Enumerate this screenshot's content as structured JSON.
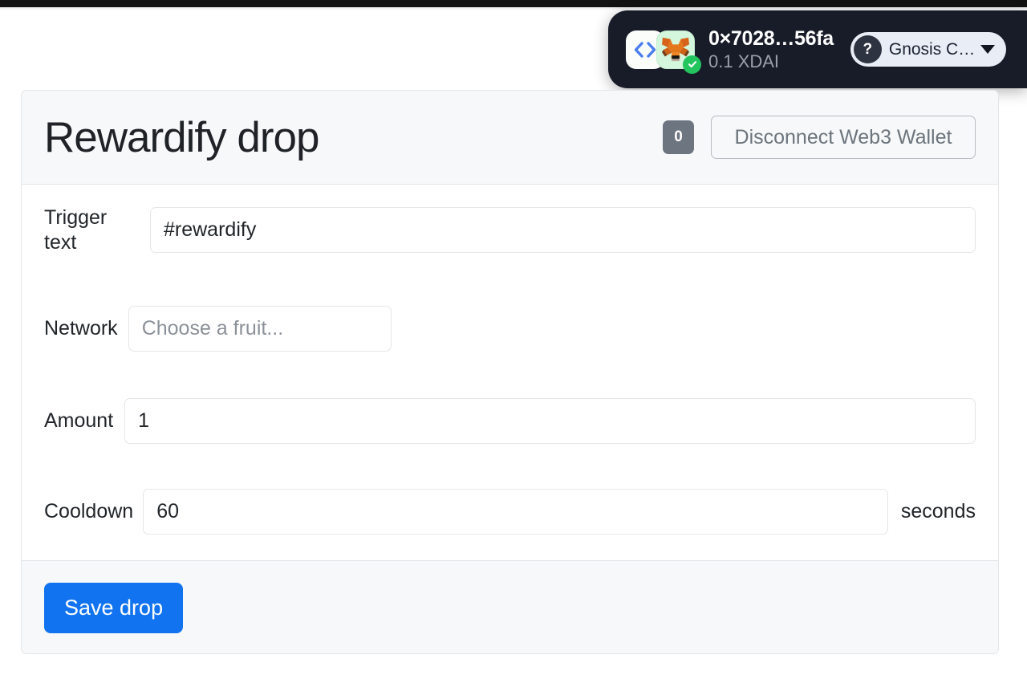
{
  "wallet": {
    "code_icon": "code-brackets-icon",
    "wallet_icon": "metamask-fox-icon",
    "status_icon": "connected-check-icon",
    "address": "0×7028…56fa",
    "balance": "0.1 XDAI",
    "network": {
      "icon": "unknown-network-question-icon",
      "label": "Gnosis C…",
      "caret": "chevron-down-icon"
    },
    "colors": {
      "widget_bg": "#181c28",
      "pill_bg": "#e9edf5",
      "check_green": "#22c55e",
      "fox_tile": "#d3f6dd"
    }
  },
  "card": {
    "title": "Rewardify drop",
    "badge_count": "0",
    "disconnect_label": "Disconnect Web3 Wallet",
    "form": {
      "trigger": {
        "label": "Trigger text",
        "value": "#rewardify",
        "placeholder": ""
      },
      "network": {
        "label": "Network",
        "value": "",
        "placeholder": "Choose a fruit..."
      },
      "amount": {
        "label": "Amount",
        "value": "1",
        "placeholder": ""
      },
      "cooldown": {
        "label": "Cooldown",
        "value": "60",
        "placeholder": "",
        "suffix": "seconds"
      }
    },
    "save_label": "Save drop",
    "colors": {
      "header_bg": "#f7f8f9",
      "border": "#e3e5e8",
      "badge_bg": "#6d7580",
      "primary": "#1273f0",
      "muted_text": "#6c757d"
    }
  }
}
